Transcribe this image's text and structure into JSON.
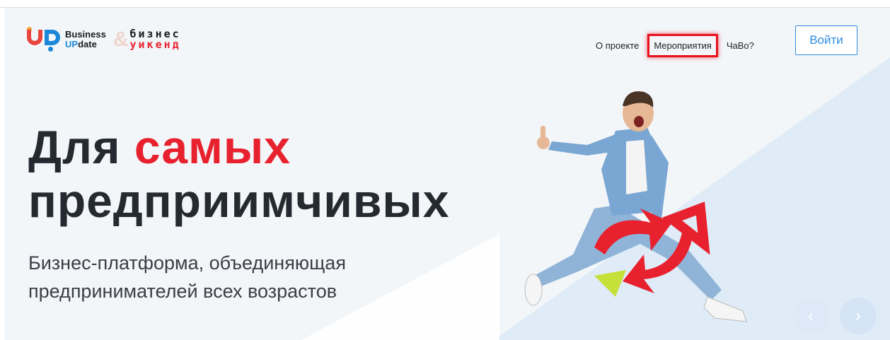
{
  "logo": {
    "business_line1": "Business",
    "business_line2_up": "UP",
    "business_line2_rest": "date",
    "ampersand": "&",
    "weekend_line1": "бизнес",
    "weekend_line2": "уикенд"
  },
  "nav": {
    "items": [
      "О проекте",
      "Мероприятия",
      "ЧаВо?"
    ],
    "highlighted": "Мероприятия",
    "login_label": "Войти"
  },
  "hero": {
    "title_word1": "Для",
    "title_word2": "самых",
    "title_line2": "предприимчивых",
    "subtitle_line1": "Бизнес-платформа, объединяющая",
    "subtitle_line2": "предпринимателей всех возрастов"
  },
  "slider": {
    "prev_icon": "chevron-left-icon",
    "next_icon": "chevron-right-icon",
    "prev_glyph": "‹",
    "next_glyph": "›"
  },
  "colors": {
    "accent_red": "#e8212e",
    "accent_blue": "#2d8de0",
    "highlight_box": "#e8101d",
    "headline": "#252a30"
  }
}
